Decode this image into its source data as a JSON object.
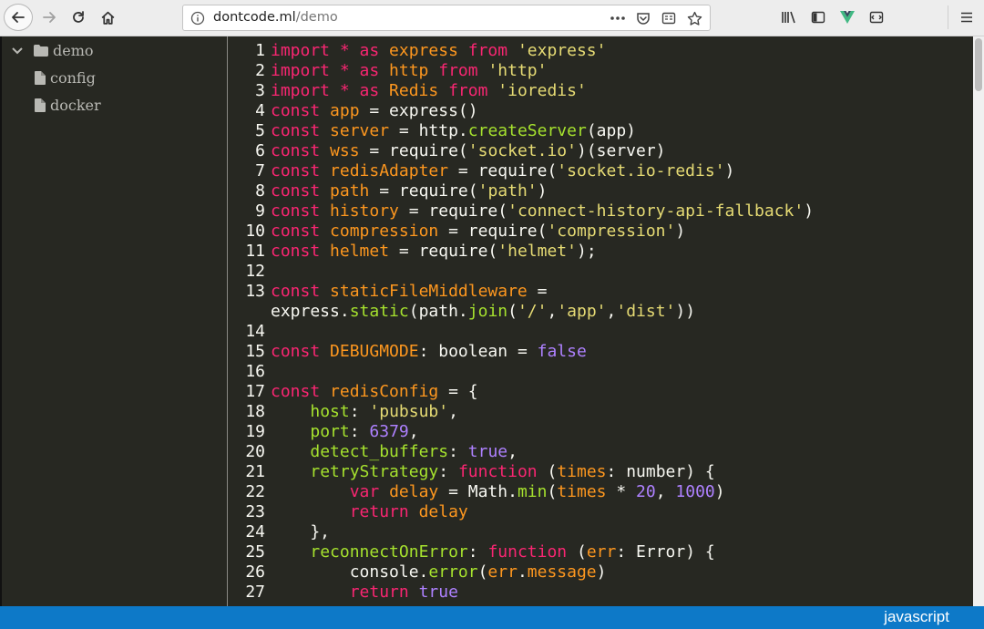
{
  "browser": {
    "url_host": "dontcode.ml",
    "url_path": "/demo",
    "icons": {
      "back": "back-arrow-icon",
      "forward": "forward-arrow-icon",
      "reload": "reload-icon",
      "home": "home-icon",
      "info": "info-icon",
      "more": "more-icon",
      "pocket": "pocket-icon",
      "reader": "reader-view-icon",
      "bookmark": "bookmark-star-icon",
      "library": "library-icon",
      "sidebar": "sidebar-toggle-icon",
      "vue_devtools": "vue-devtools-icon",
      "extension": "extension-icon",
      "menu": "hamburger-menu-icon"
    }
  },
  "sidebar": {
    "root": {
      "label": "demo",
      "expanded": true
    },
    "children": [
      {
        "label": "config"
      },
      {
        "label": "docker"
      }
    ]
  },
  "editor": {
    "line_numbers": [
      "1",
      "2",
      "3",
      "4",
      "5",
      "6",
      "7",
      "8",
      "9",
      "10",
      "11",
      "12",
      "13",
      "",
      "14",
      "15",
      "16",
      "17",
      "18",
      "19",
      "20",
      "21",
      "22",
      "23",
      "24",
      "25",
      "26",
      "27"
    ],
    "lines": [
      [
        [
          "k",
          "import * as "
        ],
        [
          "p",
          "express"
        ],
        [
          "k",
          " from "
        ],
        [
          "s",
          "'express'"
        ]
      ],
      [
        [
          "k",
          "import * as "
        ],
        [
          "p",
          "http"
        ],
        [
          "k",
          " from "
        ],
        [
          "s",
          "'http'"
        ]
      ],
      [
        [
          "k",
          "import * as "
        ],
        [
          "p",
          "Redis"
        ],
        [
          "k",
          " from "
        ],
        [
          "s",
          "'ioredis'"
        ]
      ],
      [
        [
          "k",
          "const "
        ],
        [
          "p",
          "app"
        ],
        [
          "t",
          " = express()"
        ]
      ],
      [
        [
          "k",
          "const "
        ],
        [
          "p",
          "server"
        ],
        [
          "t",
          " = http."
        ],
        [
          "f",
          "createServer"
        ],
        [
          "t",
          "(app)"
        ]
      ],
      [
        [
          "k",
          "const "
        ],
        [
          "p",
          "wss"
        ],
        [
          "t",
          " = require("
        ],
        [
          "s",
          "'socket.io'"
        ],
        [
          "t",
          ")(server)"
        ]
      ],
      [
        [
          "k",
          "const "
        ],
        [
          "p",
          "redisAdapter"
        ],
        [
          "t",
          " = require("
        ],
        [
          "s",
          "'socket.io-redis'"
        ],
        [
          "t",
          ")"
        ]
      ],
      [
        [
          "k",
          "const "
        ],
        [
          "p",
          "path"
        ],
        [
          "t",
          " = require("
        ],
        [
          "s",
          "'path'"
        ],
        [
          "t",
          ")"
        ]
      ],
      [
        [
          "k",
          "const "
        ],
        [
          "p",
          "history"
        ],
        [
          "t",
          " = require("
        ],
        [
          "s",
          "'connect-history-api-fallback'"
        ],
        [
          "t",
          ")"
        ]
      ],
      [
        [
          "k",
          "const "
        ],
        [
          "p",
          "compression"
        ],
        [
          "t",
          " = require("
        ],
        [
          "s",
          "'compression'"
        ],
        [
          "t",
          ")"
        ]
      ],
      [
        [
          "k",
          "const "
        ],
        [
          "p",
          "helmet"
        ],
        [
          "t",
          " = require("
        ],
        [
          "s",
          "'helmet'"
        ],
        [
          "t",
          ");"
        ]
      ],
      [],
      [
        [
          "k",
          "const "
        ],
        [
          "p",
          "staticFileMiddleware"
        ],
        [
          "t",
          " ="
        ]
      ],
      [
        [
          "t",
          "express."
        ],
        [
          "f",
          "static"
        ],
        [
          "t",
          "(path."
        ],
        [
          "f",
          "join"
        ],
        [
          "t",
          "("
        ],
        [
          "s",
          "'/'"
        ],
        [
          "t",
          ","
        ],
        [
          "s",
          "'app'"
        ],
        [
          "t",
          ","
        ],
        [
          "s",
          "'dist'"
        ],
        [
          "t",
          "))"
        ]
      ],
      [],
      [
        [
          "k",
          "const "
        ],
        [
          "p",
          "DEBUGMODE"
        ],
        [
          "t",
          ": boolean = "
        ],
        [
          "n",
          "false"
        ]
      ],
      [],
      [
        [
          "k",
          "const "
        ],
        [
          "p",
          "redisConfig"
        ],
        [
          "t",
          " = {"
        ]
      ],
      [
        [
          "t",
          "    "
        ],
        [
          "f",
          "host"
        ],
        [
          "t",
          ": "
        ],
        [
          "s",
          "'pubsub'"
        ],
        [
          "t",
          ","
        ]
      ],
      [
        [
          "t",
          "    "
        ],
        [
          "f",
          "port"
        ],
        [
          "t",
          ": "
        ],
        [
          "n",
          "6379"
        ],
        [
          "t",
          ","
        ]
      ],
      [
        [
          "t",
          "    "
        ],
        [
          "f",
          "detect_buffers"
        ],
        [
          "t",
          ": "
        ],
        [
          "n",
          "true"
        ],
        [
          "t",
          ","
        ]
      ],
      [
        [
          "t",
          "    "
        ],
        [
          "f",
          "retryStrategy"
        ],
        [
          "t",
          ": "
        ],
        [
          "k",
          "function"
        ],
        [
          "t",
          " ("
        ],
        [
          "p",
          "times"
        ],
        [
          "t",
          ": number) {"
        ]
      ],
      [
        [
          "t",
          "        "
        ],
        [
          "k",
          "var "
        ],
        [
          "p",
          "delay"
        ],
        [
          "t",
          " = Math."
        ],
        [
          "f",
          "min"
        ],
        [
          "t",
          "("
        ],
        [
          "p",
          "times"
        ],
        [
          "t",
          " * "
        ],
        [
          "n",
          "20"
        ],
        [
          "t",
          ", "
        ],
        [
          "n",
          "1000"
        ],
        [
          "t",
          ")"
        ]
      ],
      [
        [
          "t",
          "        "
        ],
        [
          "k",
          "return "
        ],
        [
          "p",
          "delay"
        ]
      ],
      [
        [
          "t",
          "    },"
        ]
      ],
      [
        [
          "t",
          "    "
        ],
        [
          "f",
          "reconnectOnError"
        ],
        [
          "t",
          ": "
        ],
        [
          "k",
          "function"
        ],
        [
          "t",
          " ("
        ],
        [
          "p",
          "err"
        ],
        [
          "t",
          ": Error) {"
        ]
      ],
      [
        [
          "t",
          "        console."
        ],
        [
          "f",
          "error"
        ],
        [
          "t",
          "("
        ],
        [
          "p",
          "err"
        ],
        [
          "t",
          "."
        ],
        [
          "p",
          "message"
        ],
        [
          "t",
          ")"
        ]
      ],
      [
        [
          "t",
          "        "
        ],
        [
          "k",
          "return "
        ],
        [
          "n",
          "true"
        ]
      ]
    ]
  },
  "status_bar": {
    "language": "javascript",
    "color": "#0d79c8"
  },
  "theme": {
    "keyword": "#f92672",
    "string": "#e6db74",
    "function": "#a6e22e",
    "number": "#ae81ff",
    "identifier": "#fd971f",
    "text": "#f8f8f2",
    "background": "#272822"
  }
}
